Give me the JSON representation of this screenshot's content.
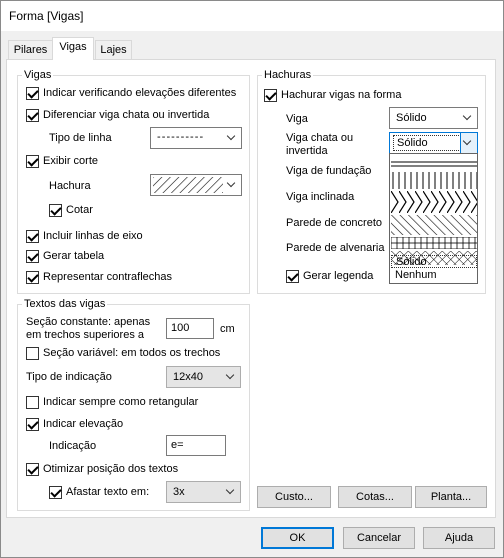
{
  "window": {
    "title": "Forma [Vigas]"
  },
  "tabs": [
    {
      "label": "Pilares"
    },
    {
      "label": "Vigas"
    },
    {
      "label": "Lajes"
    }
  ],
  "vigas": {
    "legend": "Vigas",
    "indicar_elevacoes": "Indicar verificando elevações diferentes",
    "diferenciar": "Diferenciar viga chata ou invertida",
    "tipo_linha_label": "Tipo de linha",
    "tipo_linha_value": "- - - - - - - - - -",
    "exibir_corte": "Exibir corte",
    "hachura_label": "Hachura",
    "cotar": "Cotar",
    "incluir_eixo": "Incluir linhas de eixo",
    "gerar_tabela": "Gerar tabela",
    "contraflechas": "Representar contraflechas"
  },
  "textos": {
    "legend": "Textos das vigas",
    "secao_constante": "Seção constante: apenas em trechos superiores a",
    "secao_valor": "100",
    "secao_unidade": "cm",
    "secao_variavel": "Seção variável: em todos os trechos",
    "tipo_indicacao_label": "Tipo de indicação",
    "tipo_indicacao_value": "12x40",
    "retangular": "Indicar sempre como retangular",
    "indicar_elevacao": "Indicar elevação",
    "indicacao_label": "Indicação",
    "indicacao_value": "e=",
    "otimizar": "Otimizar posição dos textos",
    "afastar": "Afastar texto em:",
    "afastar_value": "3x"
  },
  "hachuras": {
    "legend": "Hachuras",
    "hachurar": "Hachurar vigas na forma",
    "viga_label": "Viga",
    "viga_value": "Sólido",
    "chata_label": "Viga chata ou invertida",
    "chata_value": "Sólido",
    "fundacao_label": "Viga de fundação",
    "inclinada_label": "Viga inclinada",
    "concreto_label": "Parede de concreto",
    "alvenaria_label": "Parede de alvenaria",
    "gerar_legenda": "Gerar legenda",
    "dropdown_options": [
      "Sólido",
      "Nenhum"
    ]
  },
  "buttons": {
    "custo": "Custo...",
    "cotas": "Cotas...",
    "planta": "Planta...",
    "ok": "OK",
    "cancelar": "Cancelar",
    "ajuda": "Ajuda"
  }
}
